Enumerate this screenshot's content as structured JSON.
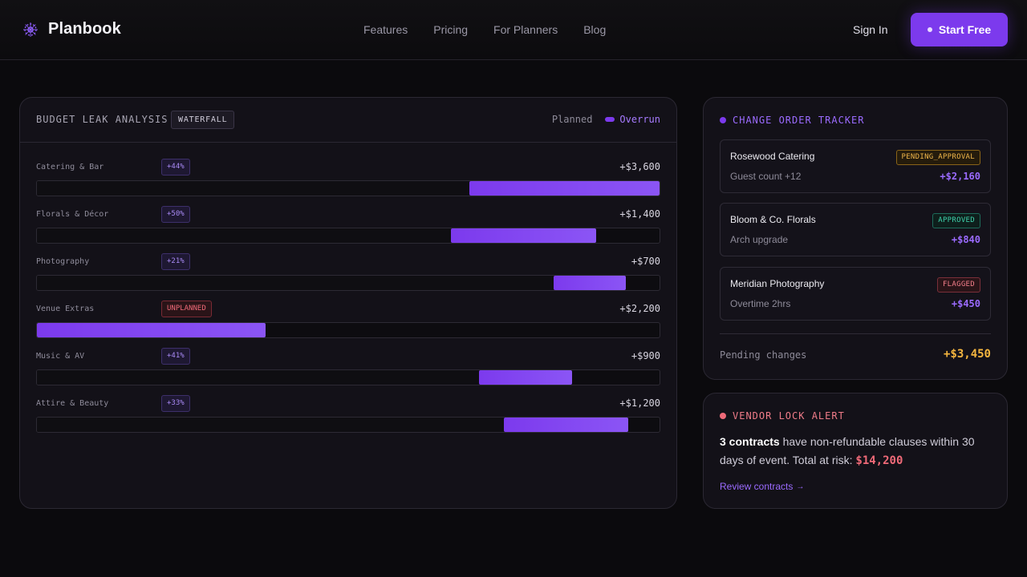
{
  "nav": {
    "brand": "Planbook",
    "links": [
      "Features",
      "Pricing",
      "For Planners",
      "Blog"
    ],
    "sign_in": "Sign In",
    "cta": "Start Free"
  },
  "budget": {
    "title": "BUDGET LEAK ANALYSIS",
    "badge": "WATERFALL",
    "legend_planned": "Planned",
    "legend_overrun": "Overrun",
    "rows": [
      {
        "label": "Catering & Bar",
        "badge": "+44%",
        "amount": "+$3,600",
        "planned_pct": 69.5,
        "overrun_pct": 30.5,
        "unplanned": false
      },
      {
        "label": "Florals & Décor",
        "badge": "+50%",
        "amount": "+$1,400",
        "planned_pct": 66.5,
        "overrun_pct": 23.3,
        "unplanned": false
      },
      {
        "label": "Photography",
        "badge": "+21%",
        "amount": "+$700",
        "planned_pct": 83.0,
        "overrun_pct": 11.6,
        "unplanned": false
      },
      {
        "label": "Venue Extras",
        "badge": "UNPLANNED",
        "amount": "+$2,200",
        "planned_pct": 0,
        "overrun_pct": 36.7,
        "unplanned": true
      },
      {
        "label": "Music & AV",
        "badge": "+41%",
        "amount": "+$900",
        "planned_pct": 71.0,
        "overrun_pct": 15.0,
        "unplanned": false
      },
      {
        "label": "Attire & Beauty",
        "badge": "+33%",
        "amount": "+$1,200",
        "planned_pct": 75.0,
        "overrun_pct": 20.0,
        "unplanned": false
      }
    ]
  },
  "tracker": {
    "title": "CHANGE ORDER TRACKER",
    "items": [
      {
        "vendor": "Rosewood Catering",
        "desc": "Guest count +12",
        "status": "PENDING_APPROVAL",
        "status_kind": "pending",
        "amount": "+$2,160"
      },
      {
        "vendor": "Bloom & Co. Florals",
        "desc": "Arch upgrade",
        "status": "APPROVED",
        "status_kind": "approved",
        "amount": "+$840"
      },
      {
        "vendor": "Meridian Photography",
        "desc": "Overtime 2hrs",
        "status": "FLAGGED",
        "status_kind": "flagged",
        "amount": "+$450"
      }
    ],
    "pending_label": "Pending changes",
    "pending_total": "+$3,450"
  },
  "alert": {
    "title": "VENDOR LOCK ALERT",
    "count": "3 contracts",
    "text": " have non-refundable clauses within 30 days of event. Total at risk: ",
    "risk": "$14,200",
    "link": "Review contracts",
    "link_arrow": "→"
  },
  "colors": {
    "accent": "#7c3aed",
    "pending": "#f0b64a",
    "approved": "#3fd3ac",
    "flagged": "#f47e8a",
    "total": "#f5b63f"
  }
}
